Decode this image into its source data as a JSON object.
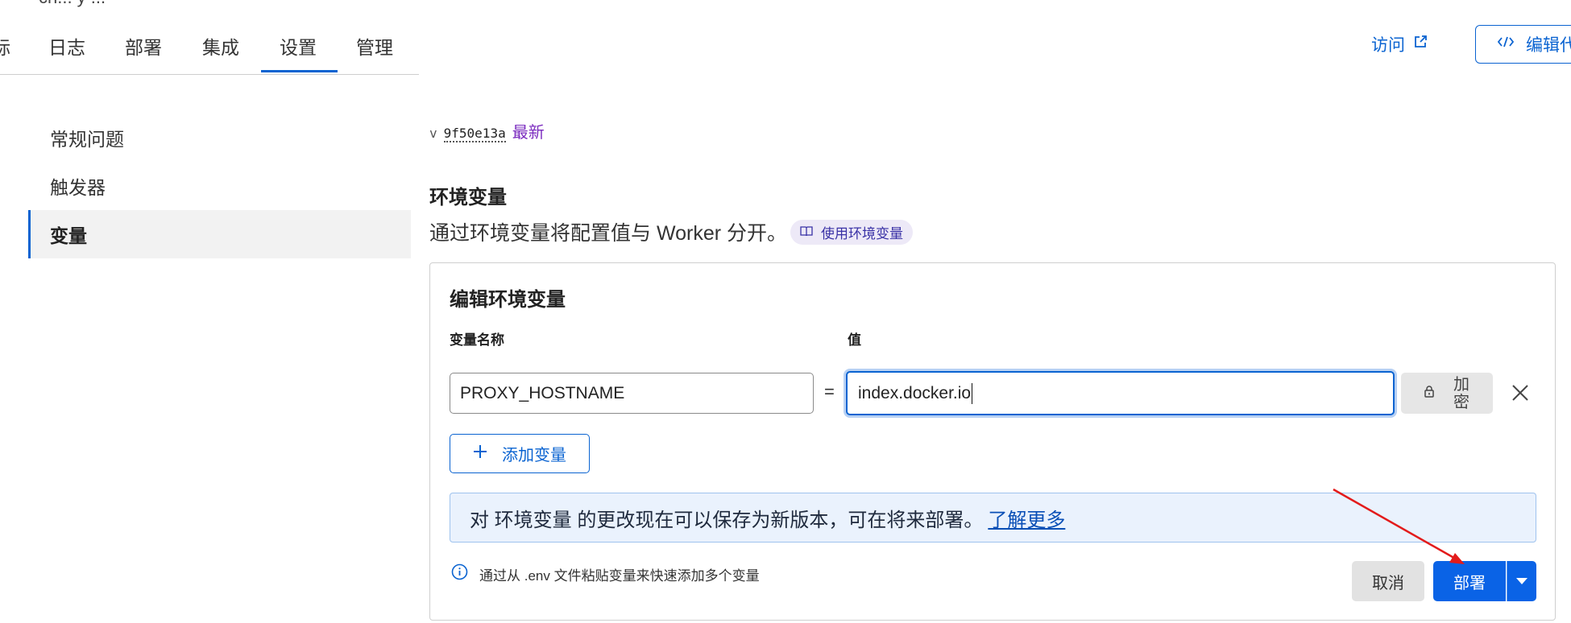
{
  "header": {
    "top_fragment": "ch... y ...",
    "tabs": [
      {
        "label": "标"
      },
      {
        "label": "日志"
      },
      {
        "label": "部署"
      },
      {
        "label": "集成"
      },
      {
        "label": "设置",
        "active": true
      },
      {
        "label": "管理"
      }
    ],
    "visit_label": "访问",
    "edit_code_label": "编辑代"
  },
  "sidebar": {
    "items": [
      {
        "label": "常规问题"
      },
      {
        "label": "触发器"
      },
      {
        "label": "变量",
        "active": true
      }
    ]
  },
  "version": {
    "prefix": "v",
    "hash": "9f50e13a",
    "badge": "最新"
  },
  "env_section": {
    "title": "环境变量",
    "description": "通过环境变量将配置值与 Worker 分开。",
    "docs_link": "使用环境变量"
  },
  "editor": {
    "title": "编辑环境变量",
    "name_col_label": "变量名称",
    "value_col_label": "值",
    "rows": [
      {
        "name": "PROXY_HOSTNAME",
        "value": "index.docker.io"
      }
    ],
    "equals": "=",
    "encrypt_label_top": "加",
    "encrypt_label_bottom": "密",
    "add_variable_label": "添加变量",
    "banner_text": "对 环境变量 的更改现在可以保存为新版本，可在将来部署。",
    "banner_link": "了解更多",
    "hint_text": "通过从 .env 文件粘贴变量来快速添加多个变量",
    "cancel_label": "取消",
    "deploy_label": "部署"
  },
  "colors": {
    "accent": "#0a63d1",
    "primary_button": "#0a63e6",
    "badge_purple": "#7b2cbf",
    "annotation_arrow": "#e31b1b"
  }
}
